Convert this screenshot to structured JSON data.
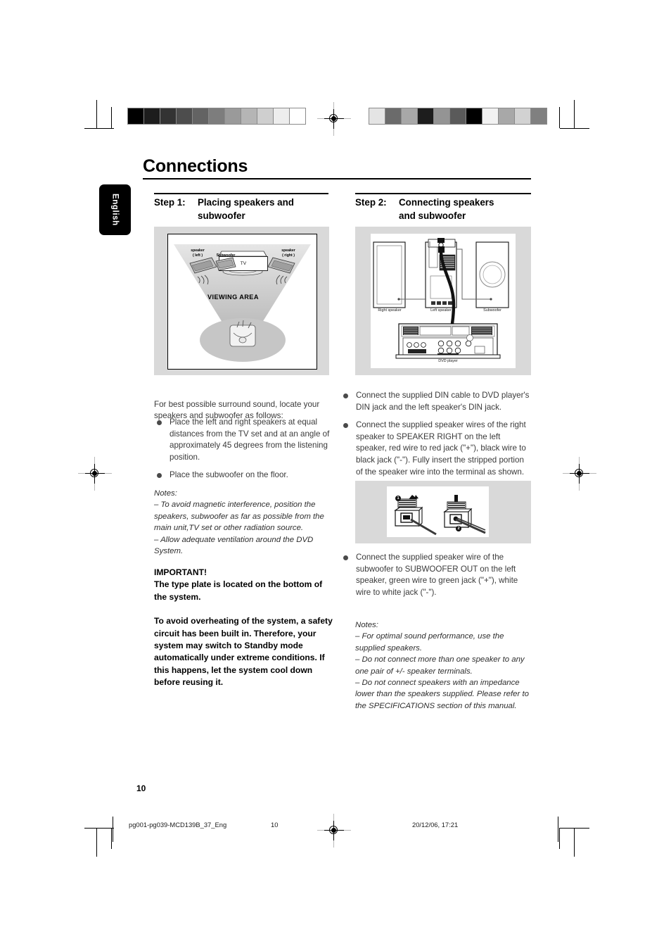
{
  "document": {
    "page_title": "Connections",
    "language_tab": "English",
    "page_number": "10"
  },
  "columns": {
    "left": {
      "step_label": "Step 1:",
      "step_title_line1": "Placing speakers and",
      "step_title_line2": "subwoofer",
      "intro": "For best possible surround sound, locate your speakers and subwoofer as follows:",
      "bullets": [
        "Place the left and right speakers at equal distances from the TV set and at an angle of approximately 45 degrees from the listening position.",
        "Place the subwoofer on the floor."
      ],
      "notes_heading": "Notes:",
      "notes": [
        "–  To avoid magnetic interference, position the speakers, subwoofer as far as possible from the main unit,TV set or other radiation source.",
        "–  Allow adequate ventilation around the DVD System."
      ],
      "important_heading": "IMPORTANT!",
      "important_line1": "The type plate is located on the bottom of the system.",
      "important_line2": "To avoid overheating of the system, a safety circuit has been built in.  Therefore, your system may switch to Standby mode automatically under extreme conditions.  If this happens, let the system cool down before reusing it."
    },
    "right": {
      "step_label": "Step 2:",
      "step_title_line1": "Connecting speakers",
      "step_title_line2": "and subwoofer",
      "bullets": [
        "Connect the supplied DIN cable to DVD player's DIN jack and the left speaker's DIN jack.",
        "Connect the supplied speaker wires of the right speaker to SPEAKER RIGHT on the left speaker, red wire to red jack (\"+\"), black wire to black jack (\"-\"). Fully insert the stripped portion of the speaker wire into the terminal as shown.",
        "Connect the supplied speaker wire of the subwoofer to SUBWOOFER OUT on the left speaker, green wire to green jack (\"+\"),  white wire to white jack (\"-\")."
      ],
      "notes_heading": "Notes:",
      "notes": [
        "–  For optimal sound performance, use the supplied speakers.",
        "–  Do not connect more than one speaker to any one pair of +/- speaker terminals.",
        "–  Do not connect speakers with an impedance lower than the speakers supplied. Please refer to the SPECIFICATIONS section of this manual."
      ]
    }
  },
  "figure_placement": {
    "label_speaker_left_l1": "speaker",
    "label_speaker_left_l2": "( left )",
    "label_subwoofer": "Subwoofer",
    "label_tv": "TV",
    "label_speaker_right_l1": "speaker",
    "label_speaker_right_l2": "( right )",
    "label_viewing_area": "VIEWING AREA"
  },
  "figure_connections": {
    "label_right_speaker": "Right speaker",
    "label_left_speaker": "Left speaker",
    "label_subwoofer": "Subwoofer",
    "label_dvd_player": "DVD player"
  },
  "figure_terminal": {
    "step_one": "1",
    "step_two": "2"
  },
  "footer": {
    "filename": "pg001-pg039-MCD139B_37_Eng",
    "page": "10",
    "timestamp": "20/12/06, 17:21"
  },
  "colors": {
    "figure_background": "#d9d9d9",
    "text_body": "#3a3a3a",
    "tab_background": "#000000"
  }
}
